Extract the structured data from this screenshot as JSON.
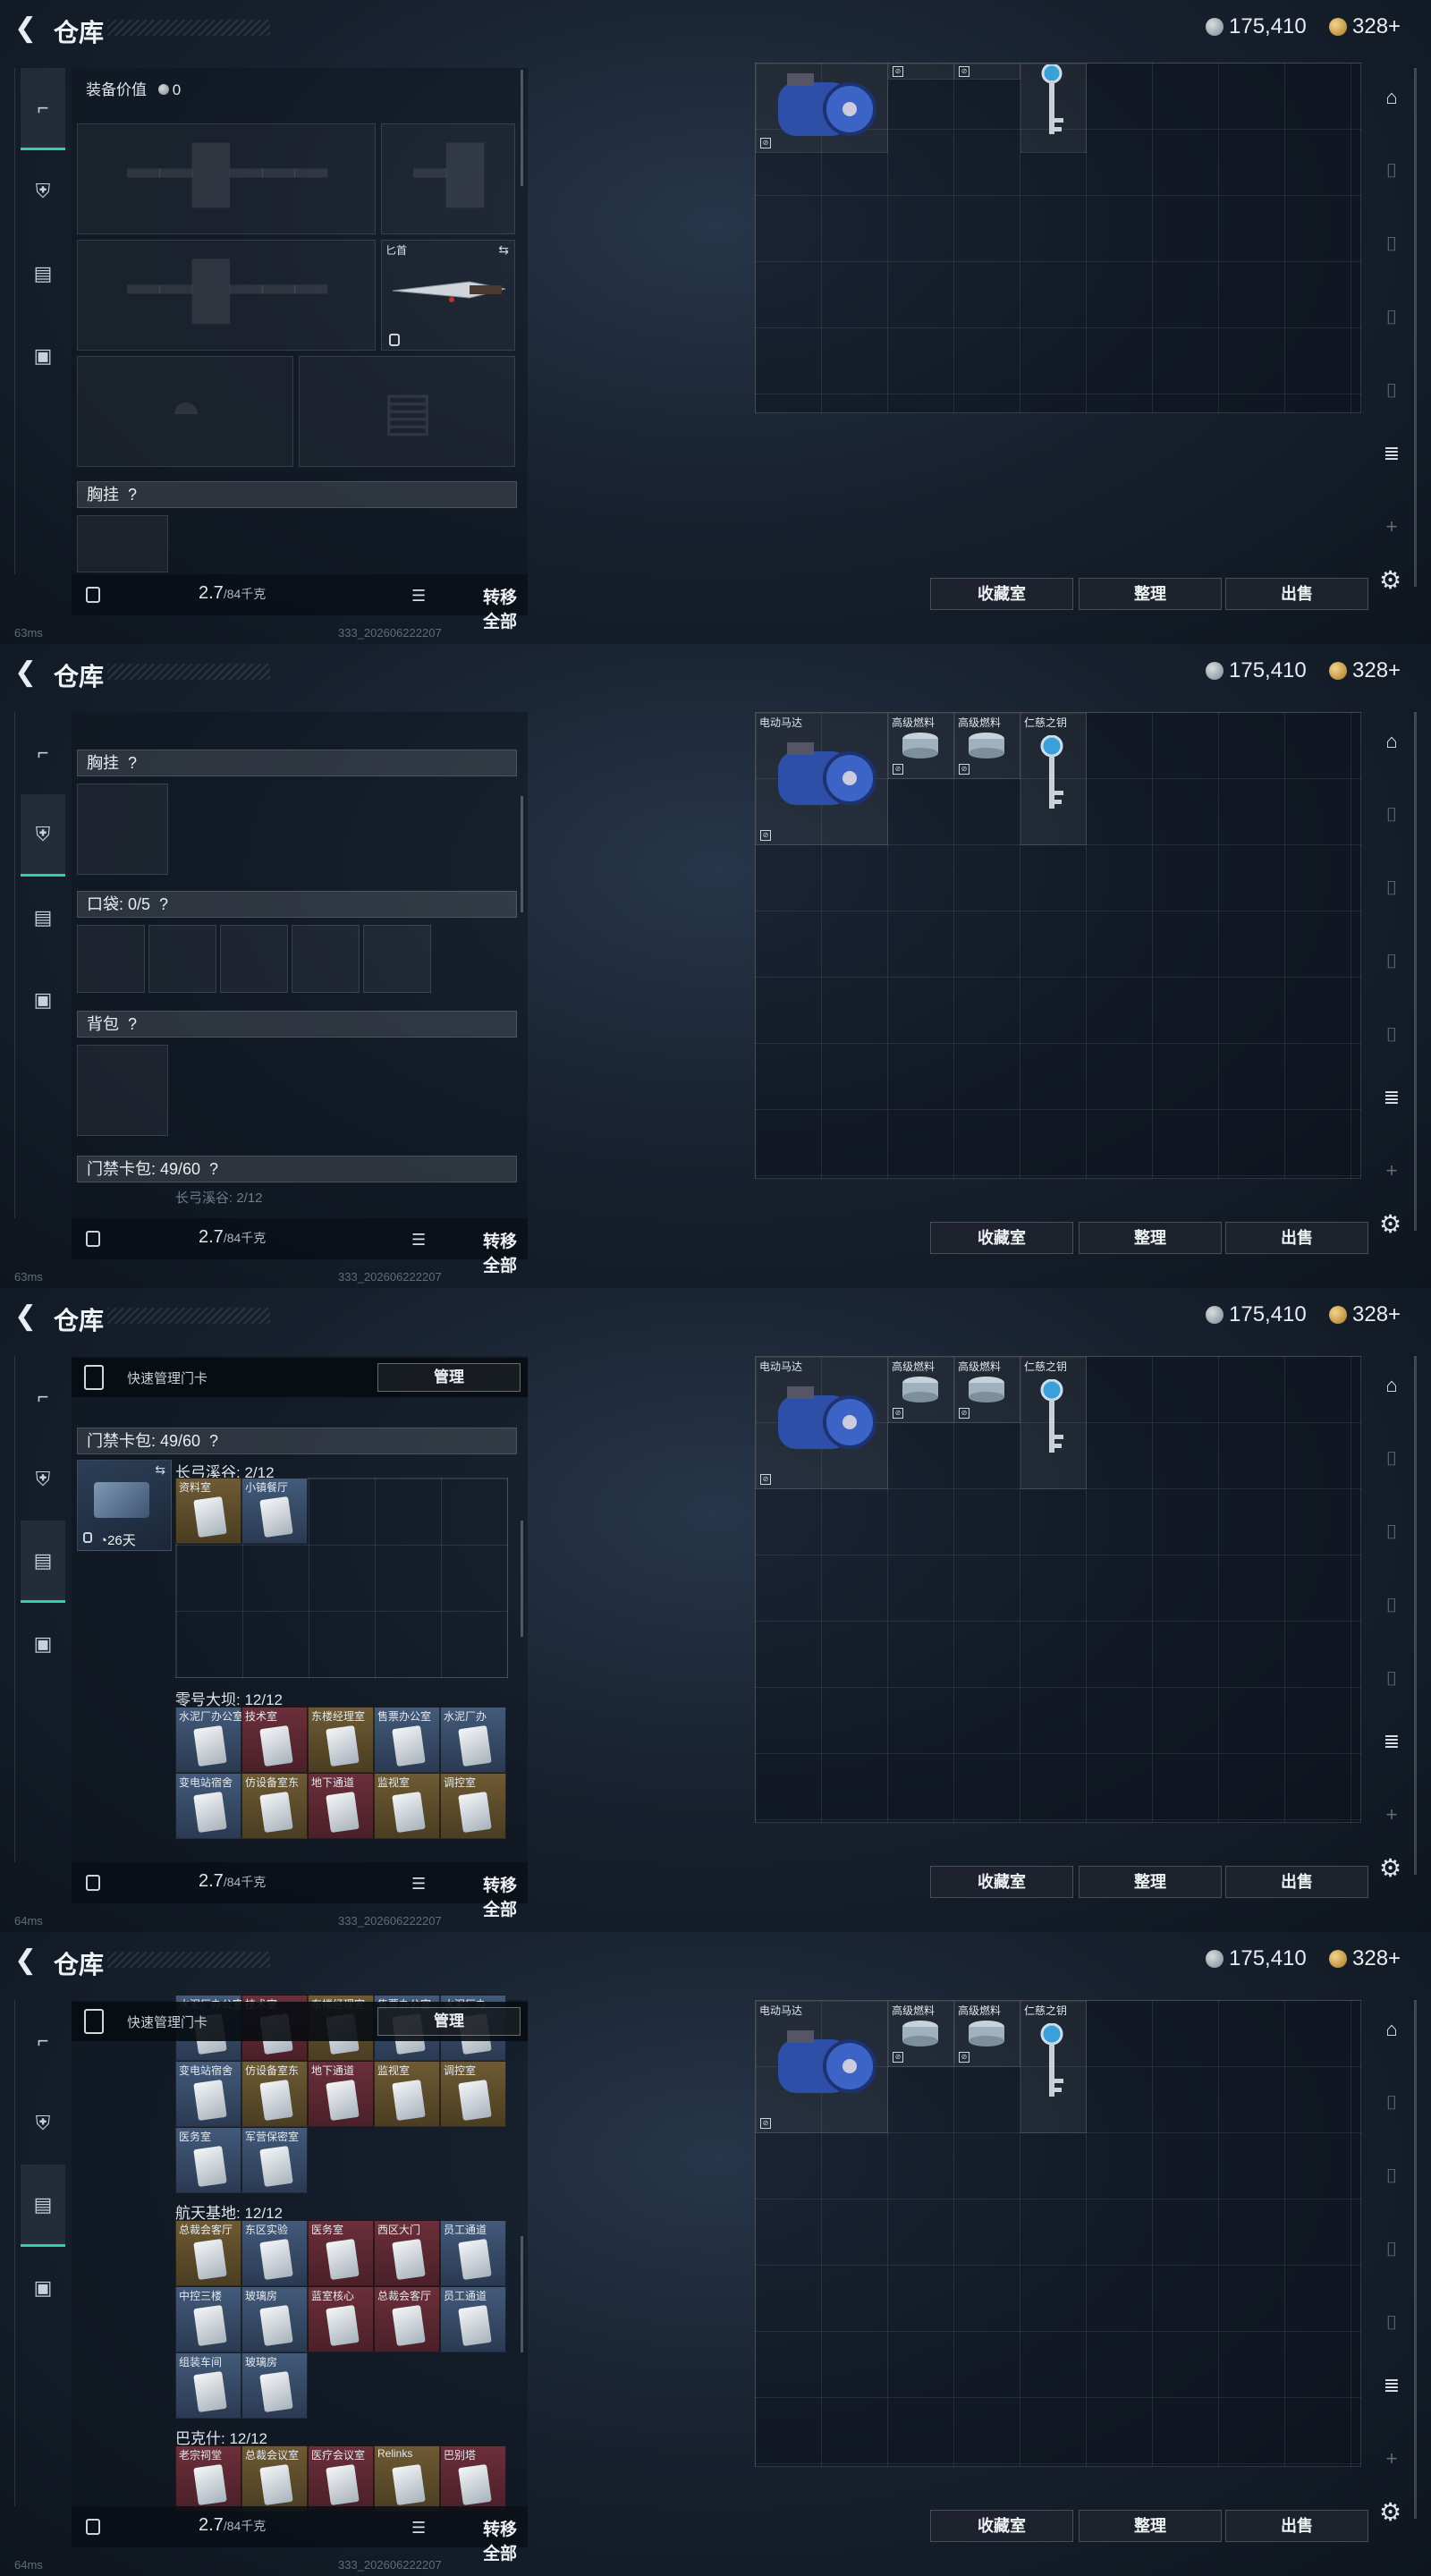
{
  "header": {
    "title": "仓库",
    "silver": "175,410",
    "gold": "328+"
  },
  "left": {
    "equip_value_label": "装备价值",
    "equip_value": "0",
    "melee_label": "匕首",
    "chest_rig": "胸挂",
    "pocket": "口袋: 0/5",
    "backpack": "背包",
    "keycard_bag": "门禁卡包: 49/60",
    "help": "?",
    "quick_manage": "快速管理门卡",
    "manage_button": "管理",
    "days_left": "26天",
    "weight_value": "2.7",
    "weight_max": "/84千克",
    "transfer_all": "转移全部",
    "sections": [
      {
        "name": "长弓溪谷: 2/12"
      },
      {
        "name": "零号大坝: 12/12"
      },
      {
        "name": "航天基地: 12/12"
      },
      {
        "name": "巴克什: 12/12"
      }
    ],
    "cards_changgong": [
      "资料室",
      "小镇餐厅"
    ],
    "cards_dam_row1": [
      "水泥厂办公室",
      "技术室",
      "东楼经理室",
      "售票办公室",
      "水泥厂办"
    ],
    "cards_dam_row2": [
      "变电站宿舍",
      "仿设备室东",
      "地下通道",
      "监视室",
      "调控室"
    ],
    "cards_dam_row3": [
      "医务室",
      "军营保密室"
    ],
    "cards_space_row1": [
      "总裁会客厅",
      "东区实验",
      "医务室",
      "西区大门",
      "员工通道"
    ],
    "cards_space_row2": [
      "中控三楼",
      "玻璃房",
      "蓝室核心",
      "总裁会客厅",
      "员工通道"
    ],
    "cards_space_row3": [
      "组装车间",
      "玻璃房"
    ],
    "cards_bakesh": [
      "老宗祠堂",
      "总裁会议室",
      "医疗会议室",
      "Relinks",
      "巴别塔"
    ]
  },
  "stash": {
    "items": [
      {
        "name": "电动马达"
      },
      {
        "name": "高级燃料"
      },
      {
        "name": "高级燃料"
      },
      {
        "name": "仁慈之钥"
      }
    ],
    "favorites": "收藏室",
    "sort": "整理",
    "sell": "出售"
  },
  "status": {
    "ping1": "63ms",
    "ping2": "63ms",
    "ping3": "64ms",
    "ping4": "64ms",
    "build": "333_202606222207"
  }
}
